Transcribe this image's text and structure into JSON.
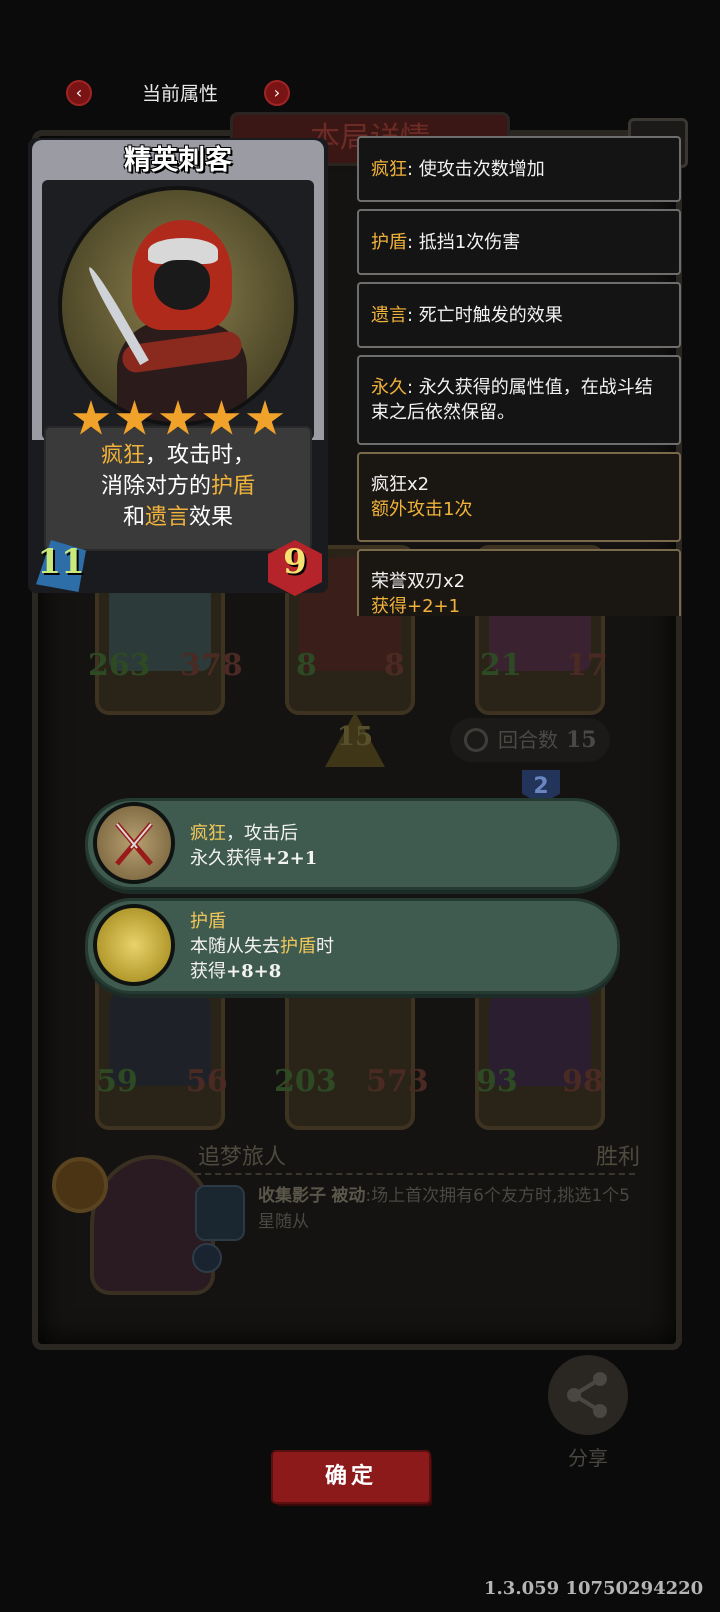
{
  "header": {
    "title": "当前属性",
    "prev_icon": "‹",
    "next_icon": "›"
  },
  "background": {
    "title": "本局详情",
    "row1": [
      {
        "atk": "263",
        "hp": "378"
      },
      {
        "atk": "8",
        "hp": "8"
      },
      {
        "atk": "21",
        "hp": "17"
      }
    ],
    "row2": [
      {
        "atk": "59",
        "hp": "56"
      },
      {
        "atk": "203",
        "hp": "573"
      },
      {
        "atk": "93",
        "hp": "98"
      }
    ],
    "turn_arrow_value": "15",
    "round_label": "回合数",
    "round_value": "15",
    "tier_badge": "2",
    "opponent": {
      "name": "追梦旅人",
      "result": "胜利",
      "skill_name": "收集影子",
      "skill_type": "被动",
      "skill_text": ":场上首次拥有6个友方时,挑选1个5星随从"
    },
    "share_label": "分享"
  },
  "card": {
    "name": "精英刺客",
    "stars": 5,
    "desc_line1_kw": "疯狂",
    "desc_line1_rest": "，攻击时，",
    "desc_line2_pre": "消除对方的",
    "desc_line2_kw": "护盾",
    "desc_line3_pre": "和",
    "desc_line3_kw": "遗言",
    "desc_line3_post": "效果",
    "attack": "11",
    "health": "9",
    "colors": {
      "attack_badge": "#2d6ea8",
      "health_badge": "#b5242a",
      "star": "#f0a22a",
      "keyword": "#f0b23a"
    }
  },
  "keywords": [
    {
      "k": "疯狂",
      "text": ": 使攻击次数增加"
    },
    {
      "k": "护盾",
      "text": ": 抵挡1次伤害"
    },
    {
      "k": "遗言",
      "text": ": 死亡时触发的效果"
    },
    {
      "k": "永久",
      "text": ": 永久获得的属性值，在战斗结束之后依然保留。"
    }
  ],
  "buffs": [
    {
      "title": "疯狂x2",
      "sub": "额外攻击1次"
    },
    {
      "title": "荣誉双刃x2",
      "sub": "获得+2+1"
    }
  ],
  "popups": [
    {
      "icon": "crossed-daggers-icon",
      "kw": "疯狂",
      "line1_rest": "，攻击后",
      "line2": "永久获得",
      "line2_bold": "+2+1"
    },
    {
      "icon": "moon-icon",
      "kw": "护盾",
      "line1_rest": "",
      "line2_pre": "本随从失去",
      "line2_kw": "护盾",
      "line2_post": "时",
      "line3": "获得",
      "line3_bold": "+8+8"
    }
  ],
  "confirm_label": "确定",
  "version": "1.3.059 10750294220"
}
